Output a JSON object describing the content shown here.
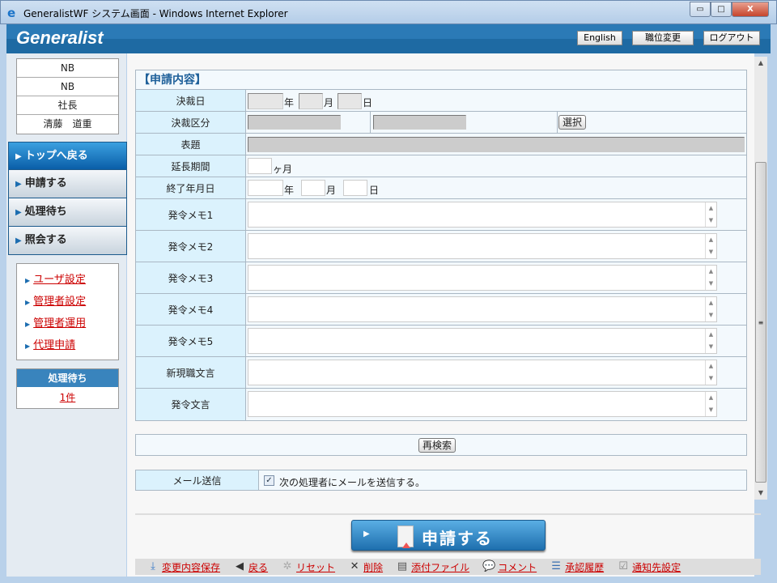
{
  "window": {
    "title": "GeneralistWF システム画面 - Windows Internet Explorer",
    "min": "▭",
    "max": "□",
    "close": "X"
  },
  "header": {
    "logo": "Generalist",
    "english": "English",
    "change_position": "職位変更",
    "logout": "ログアウト"
  },
  "sidebar": {
    "user_info": [
      "NB",
      "NB",
      "社長",
      "清藤　道重"
    ],
    "nav": [
      {
        "label": "トップへ戻る"
      },
      {
        "label": "申請する"
      },
      {
        "label": "処理待ち"
      },
      {
        "label": "照会する"
      }
    ],
    "links": [
      {
        "label": "ユーザ設定"
      },
      {
        "label": "管理者設定"
      },
      {
        "label": "管理者運用"
      },
      {
        "label": "代理申請"
      }
    ],
    "pending": {
      "title": "処理待ち",
      "count": "1件"
    }
  },
  "form": {
    "caption": "【申請内容】",
    "decision_date": {
      "label": "決裁日",
      "year": "年",
      "month": "月",
      "day": "日"
    },
    "decision_type": {
      "label": "決裁区分",
      "select": "選択"
    },
    "subject": {
      "label": "表題"
    },
    "extension": {
      "label": "延長期間",
      "unit": "ヶ月"
    },
    "end_date": {
      "label": "終了年月日",
      "year": "年",
      "month": "月",
      "day": "日"
    },
    "memos": [
      {
        "label": "発令メモ1"
      },
      {
        "label": "発令メモ2"
      },
      {
        "label": "発令メモ3"
      },
      {
        "label": "発令メモ4"
      },
      {
        "label": "発令メモ5"
      },
      {
        "label": "新現職文言"
      },
      {
        "label": "発令文言"
      }
    ]
  },
  "research": "再検索",
  "mail": {
    "label": "メール送信",
    "checkbox": "次の処理者にメールを送信する。",
    "checked": true
  },
  "submit": "申請する",
  "toolbar": [
    {
      "label": "変更内容保存",
      "icon": "download-icon"
    },
    {
      "label": "戻る",
      "icon": "back-arrow-icon"
    },
    {
      "label": "リセット",
      "icon": "reset-icon"
    },
    {
      "label": "削除",
      "icon": "delete-icon"
    },
    {
      "label": "添付ファイル",
      "icon": "attachment-icon"
    },
    {
      "label": "コメント",
      "icon": "comment-icon"
    },
    {
      "label": "承認履歴",
      "icon": "history-icon"
    },
    {
      "label": "通知先設定",
      "icon": "notify-icon"
    }
  ]
}
